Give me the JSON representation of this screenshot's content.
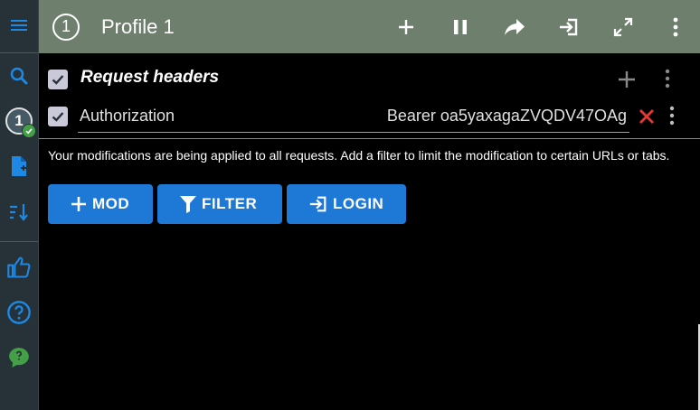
{
  "header": {
    "profile_number": "1",
    "title": "Profile 1"
  },
  "sidebar": {
    "profile_number": "1"
  },
  "request_headers": {
    "section_title": "Request headers",
    "items": [
      {
        "name": "Authorization",
        "value": "Bearer oa5yaxagaZVQDV47OAg",
        "enabled": true
      }
    ]
  },
  "notice": "Your modifications are being applied to all requests. Add a filter to limit the modification to certain URLs or tabs.",
  "buttons": {
    "mod_label": "MOD",
    "filter_label": "FILTER",
    "login_label": "LOGIN"
  },
  "colors": {
    "header_bg": "#6e7f6e",
    "sidebar_bg": "#263238",
    "button_bg": "#1e78d6",
    "icon_blue": "#1e88e5",
    "delete_red": "#e53935",
    "badge_green": "#43a047"
  }
}
